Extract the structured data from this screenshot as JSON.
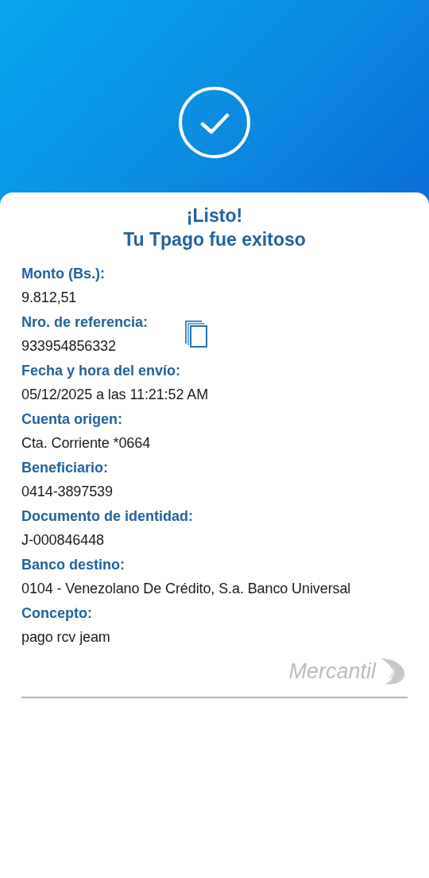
{
  "header": {
    "title": "¡Listo!",
    "subtitle": "Tu Tpago fue exitoso"
  },
  "fields": [
    {
      "label": "Monto (Bs.):",
      "value": "9.812,51",
      "copyable": false
    },
    {
      "label": "Nro. de referencia:",
      "value": "933954856332",
      "copyable": true
    },
    {
      "label": "Fecha y hora del envío:",
      "value": "05/12/2025 a las 11:21:52 AM",
      "copyable": false
    },
    {
      "label": "Cuenta origen:",
      "value": "Cta. Corriente *0664",
      "copyable": false
    },
    {
      "label": "Beneficiario:",
      "value": "0414-3897539",
      "copyable": false
    },
    {
      "label": "Documento de identidad:",
      "value": "J-000846448",
      "copyable": false
    },
    {
      "label": "Banco destino:",
      "value": "0104 - Venezolano De Crédito, S.a. Banco Universal",
      "copyable": false
    },
    {
      "label": "Concepto:",
      "value": "pago rcv jeam",
      "copyable": false
    }
  ],
  "brand": {
    "name": "Mercantil"
  }
}
